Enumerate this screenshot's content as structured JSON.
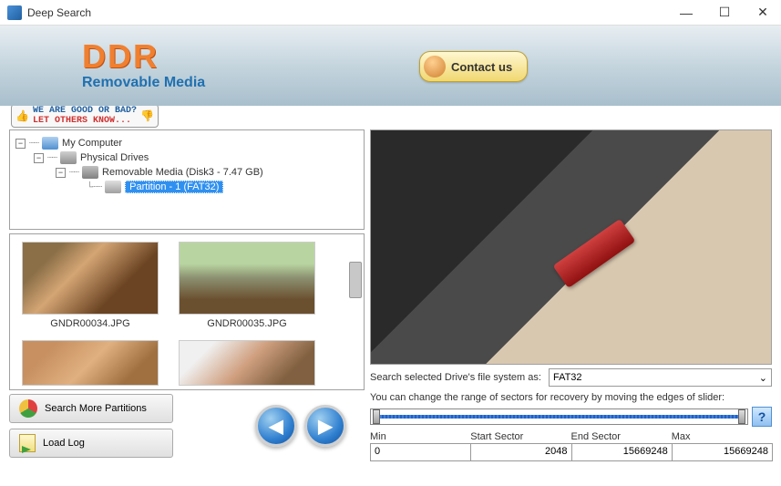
{
  "window": {
    "title": "Deep Search"
  },
  "logo": {
    "main": "DDR",
    "sub": "Removable Media"
  },
  "contact": {
    "label": "Contact us"
  },
  "feedback": {
    "line1": "WE ARE GOOD OR BAD?",
    "line2": "LET OTHERS KNOW..."
  },
  "tree": {
    "root": "My Computer",
    "drives": "Physical Drives",
    "removable": "Removable Media (Disk3 - 7.47 GB)",
    "partition": "Partition - 1 (FAT32)"
  },
  "thumbs": [
    {
      "name": "GNDR00034.JPG"
    },
    {
      "name": "GNDR00035.JPG"
    }
  ],
  "buttons": {
    "searchMore": "Search More Partitions",
    "loadLog": "Load Log"
  },
  "fs": {
    "label": "Search selected Drive's file system as:",
    "value": "FAT32"
  },
  "slider": {
    "label": "You can change the range of sectors for recovery by moving the edges of slider:"
  },
  "sectors": {
    "minLabel": "Min",
    "min": "0",
    "startLabel": "Start Sector",
    "start": "2048",
    "endLabel": "End Sector",
    "end": "15669248",
    "maxLabel": "Max",
    "max": "15669248"
  }
}
